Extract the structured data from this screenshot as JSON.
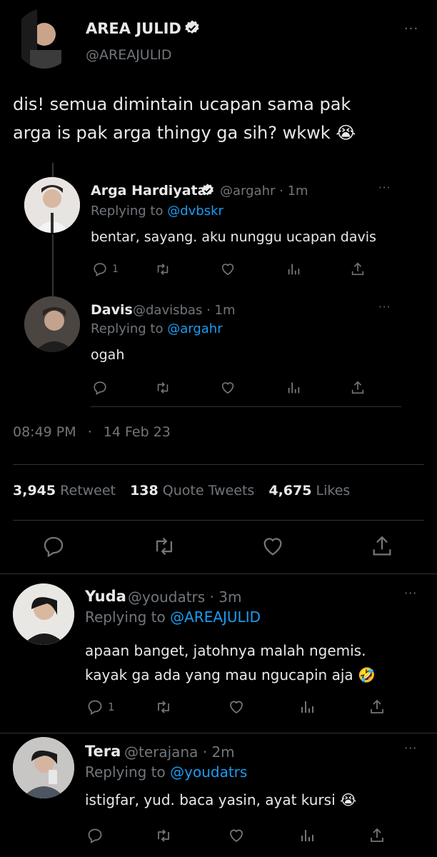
{
  "main": {
    "author": {
      "name": "AREA JULID",
      "handle": "@AREAJULID"
    },
    "text_line1": "dis! semua dimintain ucapan sama pak",
    "text_line2": "arga is pak arga thingy ga sih? wkwk",
    "text_emoji": "😭",
    "timestamp_time": "08:49 PM",
    "timestamp_sep": "·",
    "timestamp_date": "14 Feb 23",
    "stats": {
      "retweets": "3,945",
      "retweets_label": "Retweet",
      "quotes": "138",
      "quotes_label": "Quote Tweets",
      "likes": "4,675",
      "likes_label": "Likes"
    }
  },
  "quoted": [
    {
      "name": "Arga Hardiyata",
      "verified": true,
      "handle": "@argahr",
      "time": "· 1m",
      "replying_prefix": "Replying to",
      "replying_to": "@dvbskr",
      "text": "bentar, sayang. aku nunggu ucapan davis",
      "reply_count": "1"
    },
    {
      "name": "Davis",
      "handle": "@davisbas",
      "time": "· 1m",
      "replying_prefix": "Replying to",
      "replying_to": "@argahr",
      "text": "ogah"
    }
  ],
  "replies": [
    {
      "name": "Yuda",
      "handle": "@youdatrs",
      "time": "· 3m",
      "replying_prefix": "Replying to",
      "replying_to": "@AREAJULID",
      "text_line1": "apaan banget, jatohnya malah ngemis.",
      "text_line2": "kayak ga ada yang mau ngucapin aja",
      "text_emoji": "🤣",
      "reply_count": "1"
    },
    {
      "name": "Tera",
      "handle": "@terajana",
      "time": "· 2m",
      "replying_prefix": "Replying to",
      "replying_to": "@youdatrs",
      "text": "istigfar, yud. baca yasin, ayat kursi",
      "text_emoji": "😭"
    }
  ],
  "more_glyph": "···",
  "colors": {
    "background": "#000000",
    "text": "#e7e9ea",
    "muted": "#71767b",
    "link": "#1d9bf0",
    "divider": "#2f3336"
  }
}
